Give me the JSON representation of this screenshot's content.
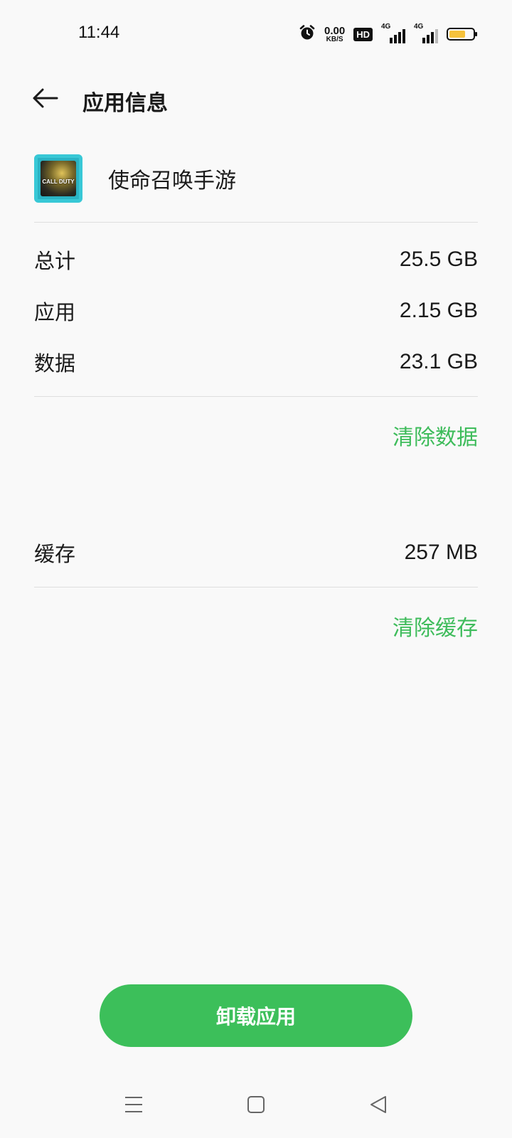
{
  "status_bar": {
    "time": "11:44",
    "net_speed_value": "0.00",
    "net_speed_unit": "KB/S",
    "hd_label": "HD",
    "signal_1_label": "4G",
    "signal_2_label": "4G",
    "battery_level": 0.7,
    "battery_color": "#f6c23b"
  },
  "header": {
    "title": "应用信息",
    "back_icon": "arrow-left-icon"
  },
  "app": {
    "name": "使命召唤手游",
    "icon_text": "CALL DUTY"
  },
  "storage": {
    "rows": [
      {
        "label": "总计",
        "value": "25.5 GB"
      },
      {
        "label": "应用",
        "value": "2.15 GB"
      },
      {
        "label": "数据",
        "value": "23.1 GB"
      }
    ],
    "clear_data_label": "清除数据"
  },
  "cache": {
    "label": "缓存",
    "value": "257 MB",
    "clear_cache_label": "清除缓存"
  },
  "uninstall_label": "卸载应用",
  "accent_color": "#3ebc5b",
  "nav_bar": {
    "menu_icon": "menu-icon",
    "home_icon": "home-square-icon",
    "back_icon": "back-triangle-icon"
  }
}
